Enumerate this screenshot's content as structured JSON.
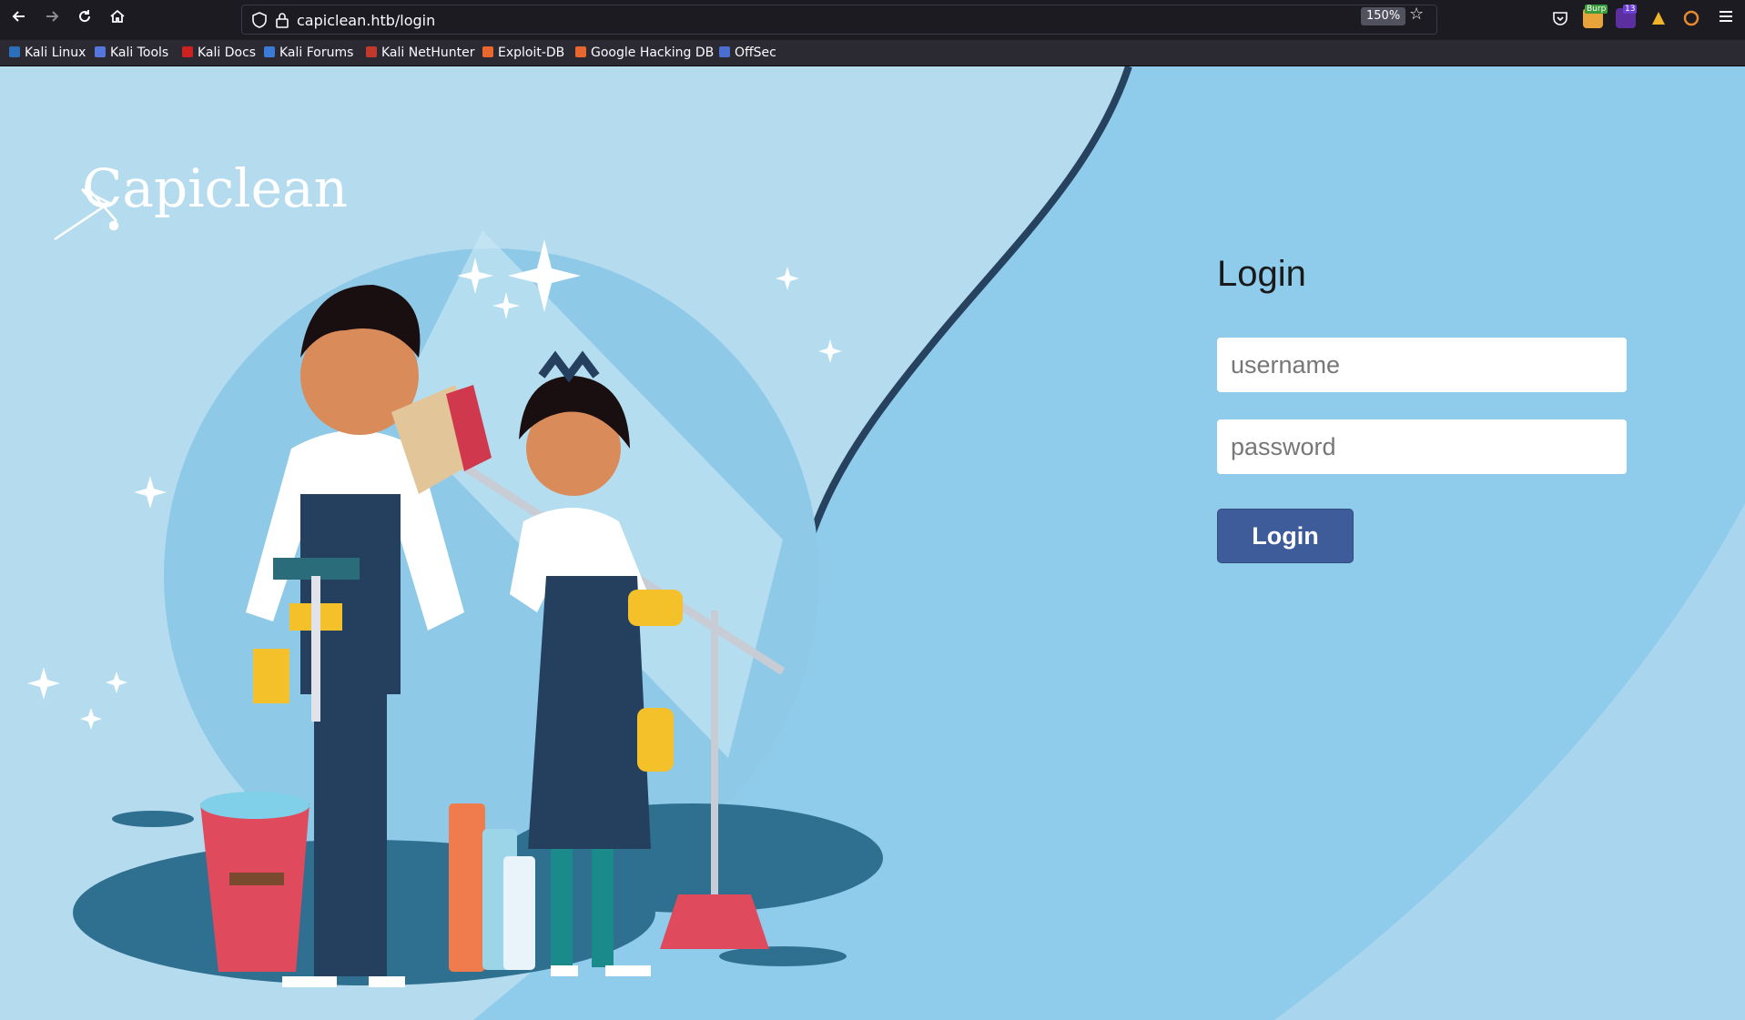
{
  "browser": {
    "url": "capiclean.htb/login",
    "zoom": "150%",
    "back_icon": "arrow-left-icon",
    "forward_icon": "arrow-right-icon",
    "reload_icon": "reload-icon",
    "home_icon": "home-icon",
    "extensions": [
      {
        "name": "burp-extension-icon",
        "badge": "Burp"
      },
      {
        "name": "wappalyzer-extension-icon",
        "badge": "13"
      },
      {
        "name": "foxyproxy-extension-icon",
        "badge": ""
      },
      {
        "name": "cookie-editor-extension-icon",
        "badge": ""
      }
    ],
    "bookmarks": [
      {
        "label": "Kali Linux"
      },
      {
        "label": "Kali Tools"
      },
      {
        "label": "Kali Docs"
      },
      {
        "label": "Kali Forums"
      },
      {
        "label": "Kali NetHunter"
      },
      {
        "label": "Exploit-DB"
      },
      {
        "label": "Google Hacking DB"
      },
      {
        "label": "OffSec"
      }
    ]
  },
  "page": {
    "logo_text": "Capiclean",
    "login_title": "Login",
    "username_placeholder": "username",
    "password_placeholder": "password",
    "login_button": "Login",
    "colors": {
      "background": "#8fcbea",
      "button": "#3d5c99"
    }
  }
}
